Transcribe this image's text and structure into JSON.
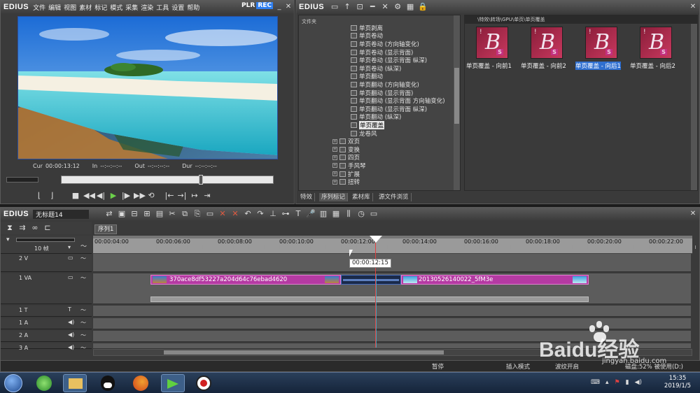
{
  "player": {
    "logo": "EDIUS",
    "menu": [
      "文件",
      "编辑",
      "视图",
      "素材",
      "标记",
      "模式",
      "采集",
      "渲染",
      "工具",
      "设置",
      "帮助"
    ],
    "mode_plr": "PLR",
    "mode_rec": "REC",
    "cur_label": "Cur",
    "cur_value": "00:00:13:12",
    "in_label": "In",
    "in_value": "--:--:--:--",
    "out_label": "Out",
    "out_value": "--:--:--:--",
    "dur_label": "Dur",
    "dur_value": "--:--:--:--"
  },
  "bin": {
    "logo": "EDIUS",
    "folder_header": "文件夹",
    "path": "\\特效\\转场\\GPU\\单页\\单页覆盖",
    "tree_items": [
      {
        "label": "单页剥离",
        "type": "leaf"
      },
      {
        "label": "单页卷动",
        "type": "leaf"
      },
      {
        "label": "单页卷动 (方向轴变化)",
        "type": "leaf"
      },
      {
        "label": "单页卷动 (显示背面)",
        "type": "leaf"
      },
      {
        "label": "单页卷动 (显示背面 纵深)",
        "type": "leaf"
      },
      {
        "label": "单页卷动 (纵深)",
        "type": "leaf"
      },
      {
        "label": "单页翻动",
        "type": "leaf"
      },
      {
        "label": "单页翻动 (方向轴变化)",
        "type": "leaf"
      },
      {
        "label": "单页翻动 (显示背面)",
        "type": "leaf"
      },
      {
        "label": "单页翻动 (显示背面 方向轴变化)",
        "type": "leaf"
      },
      {
        "label": "单页翻动 (显示背面 纵深)",
        "type": "leaf"
      },
      {
        "label": "单页翻动 (纵深)",
        "type": "leaf"
      },
      {
        "label": "单页覆盖",
        "type": "leaf",
        "selected": true
      },
      {
        "label": "龙卷风",
        "type": "leaf"
      },
      {
        "label": "双页",
        "type": "group"
      },
      {
        "label": "变换",
        "type": "group"
      },
      {
        "label": "四页",
        "type": "group"
      },
      {
        "label": "手风琴",
        "type": "group"
      },
      {
        "label": "扩展",
        "type": "group"
      },
      {
        "label": "扭转",
        "type": "group"
      }
    ],
    "effects": [
      {
        "label": "单页覆盖 - 向前1",
        "letter": "B",
        "mark": "S"
      },
      {
        "label": "单页覆盖 - 向前2",
        "letter": "B",
        "mark": "S"
      },
      {
        "label": "单页覆盖 - 向后1",
        "letter": "B",
        "mark": "S",
        "selected": true
      },
      {
        "label": "单页覆盖 - 向后2",
        "letter": "B",
        "mark": "S"
      }
    ],
    "tabs": [
      "特效",
      "序列标记",
      "素材库",
      "源文件浏览"
    ]
  },
  "timeline": {
    "logo": "EDIUS",
    "project_name": "无标题14",
    "sequence_tab": "序列1",
    "zoom_label": "10 帧",
    "ruler": [
      "00:00:04:00",
      "00:00:06:00",
      "00:00:08:00",
      "00:00:10:00",
      "00:00:12:00",
      "00:00:14:00",
      "00:00:16:00",
      "00:00:18:00",
      "00:00:20:00",
      "00:00:22:00"
    ],
    "tooltip": "00:00:12:15",
    "tracks": [
      {
        "name": "2 V"
      },
      {
        "name": "1 VA"
      },
      {
        "name": "1 T"
      },
      {
        "name": "1 A"
      },
      {
        "name": "2 A"
      },
      {
        "name": "3 A"
      }
    ],
    "clip1_name": "370ace8df53227a204d64c76ebad4620",
    "clip2_name": "20130526140022_5fM3e",
    "status": {
      "pause": "暂停",
      "insert_mode": "插入模式",
      "ripple": "波纹开启",
      "disk": "磁盘:52% 被使用(D:)"
    }
  },
  "taskbar": {
    "time": "15:35",
    "date": "2019/1/5"
  },
  "watermark": {
    "text": "Baidu经验",
    "url": "jingyan.baidu.com"
  },
  "colors": {
    "accent_blue": "#2f6fd0",
    "clip_magenta": "#b53aa3",
    "play_green": "#6bd04a",
    "rec_blue": "#2f7ff0"
  }
}
